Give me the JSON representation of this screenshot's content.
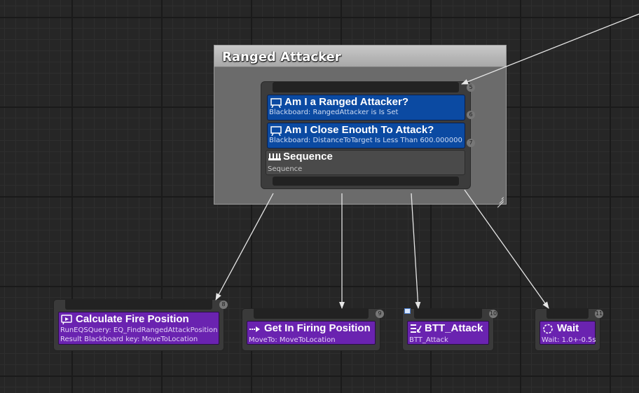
{
  "comment": {
    "title": "Ranged Attacker"
  },
  "composite": {
    "index": "5",
    "decorators": [
      {
        "title": "Am I a Ranged Attacker?",
        "subtitle": "Blackboard: RangedAttacker is Is Set",
        "index": "6",
        "icon": "blackboard-decorator-icon"
      },
      {
        "title": "Am I Close Enouth To Attack?",
        "subtitle": "Blackboard: DistanceToTarget Is Less Than 600.000000",
        "index": "7",
        "icon": "blackboard-decorator-icon"
      }
    ],
    "sequence": {
      "title": "Sequence",
      "subtitle": "Sequence",
      "icon": "sequence-icon"
    }
  },
  "tasks": [
    {
      "title": "Calculate Fire Position",
      "subtitle1": "RunEQSQuery: EQ_FindRangedAttackPosition",
      "subtitle2": "Result Blackboard key: MoveToLocation",
      "index": "8",
      "icon": "eqs-query-icon"
    },
    {
      "title": "Get In Firing Position",
      "subtitle1": "MoveTo: MoveToLocation",
      "index": "9",
      "icon": "move-to-icon"
    },
    {
      "title": "BTT_Attack",
      "subtitle1": "BTT_Attack",
      "index": "10",
      "icon": "task-icon"
    },
    {
      "title": "Wait",
      "subtitle1": "Wait: 1.0+-0.5s",
      "index": "11",
      "icon": "wait-icon"
    }
  ],
  "colors": {
    "graph_background": "#262626",
    "decorator_blue": "#0b4aa2",
    "task_purple": "#6a23b0",
    "wire": "#e6e6e6"
  }
}
